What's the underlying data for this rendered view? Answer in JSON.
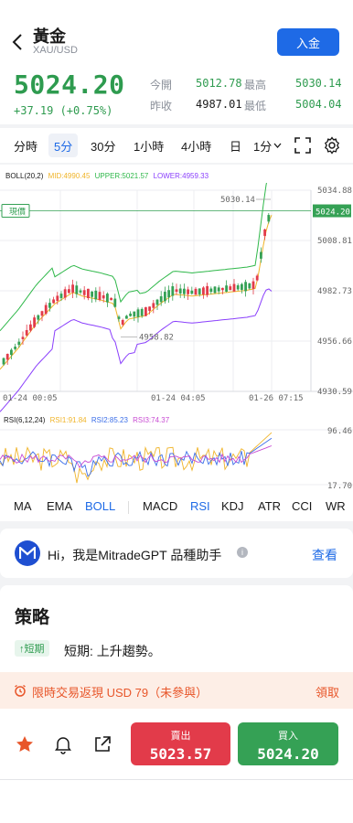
{
  "header": {
    "title": "黃金",
    "subtitle": "XAU/USD",
    "deposit_label": "入金"
  },
  "quote": {
    "price": "5024.20",
    "change": "+37.19 (+0.75%)",
    "open_label": "今開",
    "open_value": "5012.78",
    "high_label": "最高",
    "high_value": "5030.14",
    "prev_label": "昨收",
    "prev_value": "4987.01",
    "low_label": "最低",
    "low_value": "5004.04"
  },
  "period_tabs": [
    "分時",
    "5分",
    "30分",
    "1小時",
    "4小時",
    "日",
    "1分"
  ],
  "active_period": "5分",
  "chart": {
    "boll_name": "BOLL(20,2)",
    "boll_mid": "MID:4990.45",
    "boll_upper": "UPPER:5021.57",
    "boll_lower": "LOWER:4959.33",
    "current_label": "現價",
    "current_price": "5024.20",
    "high_marker": "5030.14",
    "low_marker": "4958.82",
    "price_ticks": [
      "5034.88",
      "5008.81",
      "4982.73",
      "4956.66",
      "4930.59"
    ],
    "time_ticks": [
      "01-24 00:05",
      "01-24 04:05",
      "01-26 07:15"
    ],
    "rsi_name": "RSI(6,12,24)",
    "rsi1": "RSI1:91.84",
    "rsi2": "RSI2:85.23",
    "rsi3": "RSI3:74.37",
    "rsi_ticks": [
      "96.46",
      "17.70"
    ],
    "colors": {
      "mid": "#f0b429",
      "upper": "#2fb84a",
      "lower": "#8a3ffc",
      "up_candle": "#35a155",
      "down_candle": "#e23b4a",
      "rsi1": "#f0b429",
      "rsi2": "#3b6ee8",
      "rsi3": "#c84bd3"
    }
  },
  "chart_data": {
    "type": "candlestick",
    "y_range": [
      4930.59,
      5034.88
    ],
    "x_labels": [
      "01-24 00:05",
      "01-24 04:05",
      "01-26 07:15"
    ],
    "current": 5024.2,
    "high": 5030.14,
    "low": 4958.82,
    "boll": {
      "mid": 4990.45,
      "upper": 5021.57,
      "lower": 4959.33
    },
    "rsi": {
      "rsi1": 91.84,
      "rsi2": 85.23,
      "rsi3": 74.37,
      "range": [
        17.7,
        96.46
      ]
    }
  },
  "indicators": [
    "MA",
    "EMA",
    "BOLL",
    "MACD",
    "RSI",
    "KDJ",
    "ATR",
    "CCI",
    "WR"
  ],
  "active_indicators": [
    "BOLL",
    "RSI"
  ],
  "gpt": {
    "text": "Hi，我是MitradeGPT 品種助手",
    "link": "查看"
  },
  "strategy": {
    "title": "策略",
    "badge": "↑短期",
    "text": "短期: 上升趨勢。"
  },
  "promo": {
    "text": "限時交易返現 USD 79（未參與）",
    "claim": "領取"
  },
  "trade": {
    "sell_label": "賣出",
    "sell_price": "5023.57",
    "buy_label": "買入",
    "buy_price": "5024.20"
  }
}
